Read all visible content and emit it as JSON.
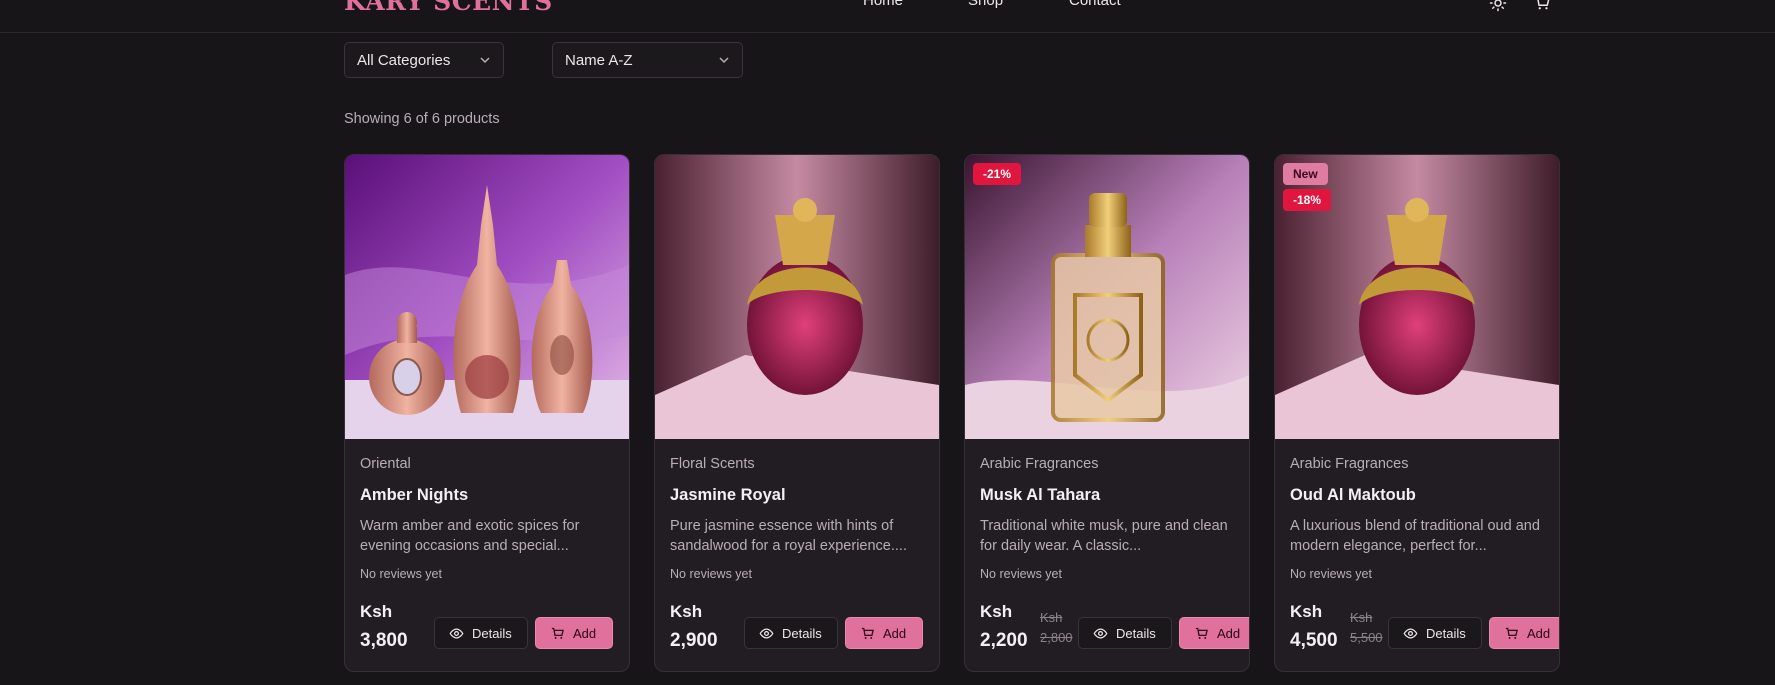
{
  "header": {
    "brand": "KARY SCENTS",
    "nav": [
      "Home",
      "Shop",
      "Contact"
    ],
    "icons": [
      "sun-icon",
      "cart-icon"
    ]
  },
  "filters": {
    "category": "All Categories",
    "sort": "Name A-Z"
  },
  "results_text": "Showing 6 of 6 products",
  "buttons": {
    "details": "Details",
    "add": "Add"
  },
  "products": [
    {
      "category": "Oriental",
      "name": "Amber Nights",
      "description": "Warm amber and exotic spices for evening occasions and special...",
      "reviews": "No reviews yet",
      "currency": "Ksh",
      "price": "3,800",
      "badges": []
    },
    {
      "category": "Floral Scents",
      "name": "Jasmine Royal",
      "description": "Pure jasmine essence with hints of sandalwood for a royal experience....",
      "reviews": "No reviews yet",
      "currency": "Ksh",
      "price": "2,900",
      "badges": []
    },
    {
      "category": "Arabic Fragrances",
      "name": "Musk Al Tahara",
      "description": "Traditional white musk, pure and clean for daily wear. A classic...",
      "reviews": "No reviews yet",
      "currency": "Ksh",
      "price": "2,200",
      "old_currency": "Ksh",
      "old_price": "2,800",
      "badges": [
        "-21%"
      ]
    },
    {
      "category": "Arabic Fragrances",
      "name": "Oud Al Maktoub",
      "description": "A luxurious blend of traditional oud and modern elegance, perfect for...",
      "reviews": "No reviews yet",
      "currency": "Ksh",
      "price": "4,500",
      "old_currency": "Ksh",
      "old_price": "5,500",
      "badges": [
        "New",
        "-18%"
      ]
    }
  ],
  "colors": {
    "background": "#181519",
    "card": "#221d23",
    "accent": "#e0709c",
    "sale": "#e0163e"
  }
}
